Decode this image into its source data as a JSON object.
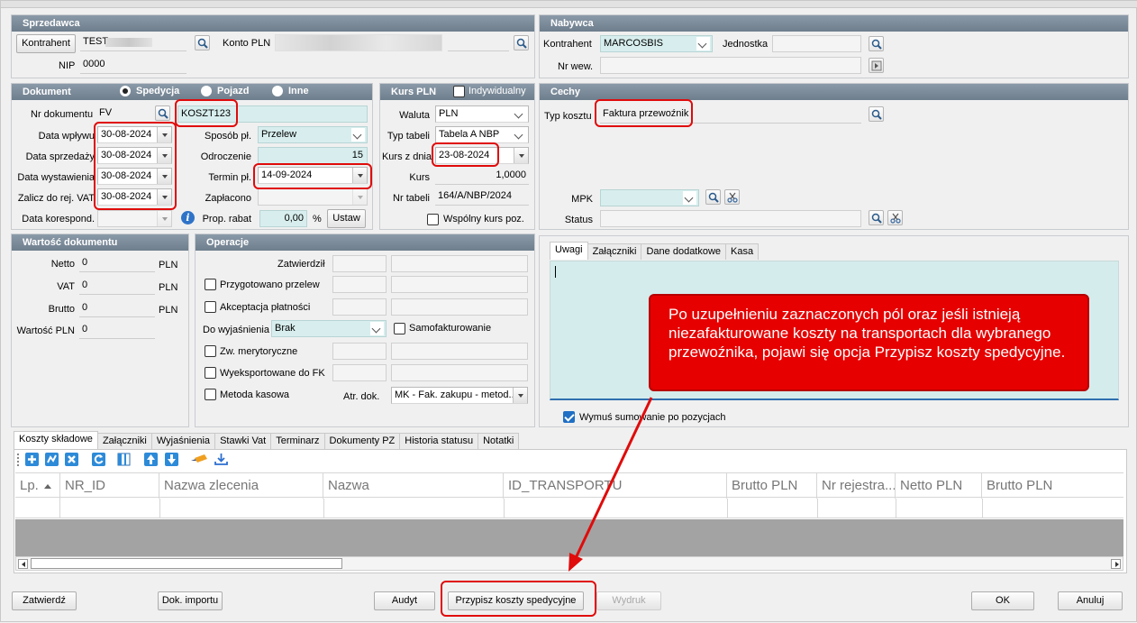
{
  "seller": {
    "header": "Sprzedawca",
    "contractor_btn": "Kontrahent",
    "contractor_value": "TEST",
    "account_label": "Konto PLN",
    "nip_label": "NIP",
    "nip_value": "0000"
  },
  "buyer": {
    "header": "Nabywca",
    "contractor_label": "Kontrahent",
    "contractor_value": "MARCOSBIS",
    "unit_label": "Jednostka",
    "internal_no_label": "Nr wew."
  },
  "document": {
    "header": "Dokument",
    "radio_options": [
      "Spedycja",
      "Pojazd",
      "Inne"
    ],
    "selected_radio": "Spedycja",
    "doc_no_label": "Nr dokumentu",
    "doc_type": "FV",
    "doc_no_value": "KOSZT123",
    "receipt_date_label": "Data wpływu",
    "receipt_date": "30-08-2024",
    "sale_date_label": "Data sprzedaży",
    "sale_date": "30-08-2024",
    "issue_date_label": "Data wystawienia",
    "issue_date": "30-08-2024",
    "vat_reg_label": "Zalicz do rej. VAT",
    "vat_reg_date": "30-08-2024",
    "corresp_date_label": "Data korespond.",
    "payment_method_label": "Sposób pł.",
    "payment_method": "Przelew",
    "deferral_label": "Odroczenie",
    "deferral_value": "15",
    "due_date_label": "Termin pł.",
    "due_date": "14-09-2024",
    "paid_label": "Zapłacono",
    "discount_label": "Prop. rabat",
    "discount_value": "0,00",
    "discount_unit": "%",
    "set_btn": "Ustaw"
  },
  "rate": {
    "header": "Kurs PLN",
    "individual_label": "Indywidualny",
    "currency_label": "Waluta",
    "currency": "PLN",
    "table_type_label": "Typ tabeli",
    "table_type": "Tabela A NBP",
    "rate_date_label": "Kurs z dnia",
    "rate_date": "23-08-2024",
    "rate_label": "Kurs",
    "rate_value": "1,0000",
    "table_no_label": "Nr tabeli",
    "table_no": "164/A/NBP/2024",
    "common_rate_label": "Wspólny kurs poz."
  },
  "features": {
    "header": "Cechy",
    "cost_type_label": "Typ kosztu",
    "cost_type": "Faktura przewoźnik",
    "mpk_label": "MPK",
    "status_label": "Status"
  },
  "value": {
    "header": "Wartość dokumentu",
    "rows": [
      {
        "label": "Netto",
        "value": "0",
        "unit": "PLN"
      },
      {
        "label": "VAT",
        "value": "0",
        "unit": "PLN"
      },
      {
        "label": "Brutto",
        "value": "0",
        "unit": "PLN"
      },
      {
        "label": "Wartość PLN",
        "value": "0",
        "unit": ""
      }
    ]
  },
  "operations": {
    "header": "Operacje",
    "approved_label": "Zatwierdził",
    "prepared_transfer": "Przygotowano przelew",
    "payment_accept": "Akceptacja płatności",
    "to_explain_label": "Do wyjaśnienia",
    "to_explain_value": "Brak",
    "self_invoicing": "Samofakturowanie",
    "merit_label": "Zw. merytoryczne",
    "exported_label": "Wyeksportowane do FK",
    "cash_method": "Metoda kasowa",
    "doc_attr_label": "Atr. dok.",
    "doc_attr_value": "MK - Fak. zakupu - metod..."
  },
  "notes_tabs": [
    "Uwagi",
    "Załączniki",
    "Dane dodatkowe",
    "Kasa"
  ],
  "force_sum_label": "Wymuś sumowanie po pozycjach",
  "callout_text": "Po uzupełnieniu zaznaczonych pól oraz jeśli istnieją niezafakturowane koszty na transportach dla wybranego przewoźnika, pojawi się opcja Przypisz koszty spedycyjne.",
  "bottom_tabs": [
    "Koszty składowe",
    "Załączniki",
    "Wyjaśnienia",
    "Stawki Vat",
    "Terminarz",
    "Dokumenty PZ",
    "Historia statusu",
    "Notatki"
  ],
  "grid_columns": [
    "Lp.",
    "NR_ID",
    "Nazwa zlecenia",
    "Nazwa",
    "ID_TRANSPORTU",
    "Brutto PLN",
    "Nr rejestra...",
    "Netto PLN",
    "Brutto PLN"
  ],
  "footer": {
    "approve": "Zatwierdź",
    "import_docs": "Dok. importu",
    "audit": "Audyt",
    "assign_costs": "Przypisz koszty spedycyjne",
    "print": "Wydruk",
    "ok": "OK",
    "cancel": "Anuluj"
  },
  "colors": {
    "header_bar": "#7a8a99",
    "highlight": "#e00b0b",
    "teal_field": "#d8eeee"
  }
}
